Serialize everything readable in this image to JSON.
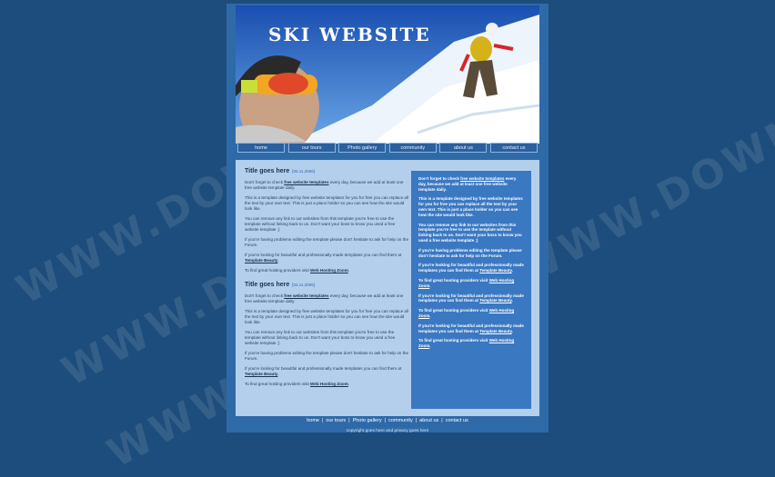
{
  "watermark": "WWW.DOWNDEMO",
  "header": {
    "title": "SKI WEBSITE"
  },
  "nav": [
    "home",
    "our tours",
    "Photo gallery",
    "community",
    "about us",
    "contact us"
  ],
  "posts": [
    {
      "title": "Title goes here",
      "date": "[05.11.2006]",
      "p1_pre": "Don't forget to check ",
      "p1_link": "free website templates",
      "p1_post": " every day, because we add at least one free website template daily.",
      "p2": "This is a template designed by free website templates for you for free you can replace all the text by your own text. This is just a place holder so you can see how the site would look like.",
      "p3": "You can remove any link to our websites from this template you're free to use the template without linking back to us. Don't want your boss to know you used a free website template ;)",
      "p4": "If you're having problems editing the template please don't hesitate to ask for help on the Forum.",
      "p5_pre": "If you're looking for beautiful and professionally made templates you can find them at ",
      "p5_link": "Template Beauty",
      "p5_post": ".",
      "p6_pre": "To find great hosting providers visit ",
      "p6_link": "Web Hosting Zoom",
      "p6_post": "."
    },
    {
      "title": "Title goes here",
      "date": "[04.11.2006]",
      "p1_pre": "Don't forget to check ",
      "p1_link": "free website templates",
      "p1_post": " every day, because we add at least one free website template daily.",
      "p2": "This is a template designed by free website templates for you for free you can replace all the text by your own text. This is just a place holder so you can see how the site would look like.",
      "p3": "You can remove any link to our websites from this template you're free to use the template without linking back to us. Don't want your boss to know you used a free website template ;)",
      "p4": "If you're having problems editing the template please don't hesitate to ask for help on the Forum.",
      "p5_pre": "If you're looking for beautiful and professionally made templates you can find them at ",
      "p5_link": "Template Beauty",
      "p5_post": ".",
      "p6_pre": "To find great hosting providers visit ",
      "p6_link": "Web Hosting Zoom",
      "p6_post": "."
    }
  ],
  "sidebar": {
    "s1_pre": "Don't forget to check ",
    "s1_link": "free website templates",
    "s1_post": " every day, because we add at least one free website template daily.",
    "s2": "This is a template designed by free website templates for you for free you can replace all the text by your own text. This is just a place holder so you can see how the site would look like.",
    "s3": "You can remove any link to our websites from this template you're free to use the template without linking back to us. Don't want your boss to know you used a free website template ;)",
    "s4": "If you're having problems editing the template please don't hesitate to ask for help on the Forum.",
    "s5_pre": "If you're looking for beautiful and professionally made templates you can find them at ",
    "s5_link": "Template Beauty",
    "s5_post": ".",
    "s6_pre": "To find great hosting providers visit ",
    "s6_link": "Web Hosting Zoom",
    "s6_post": ".",
    "s7_pre": "If you're looking for beautiful and professionally made templates you can find them at ",
    "s7_link": "Template Beauty",
    "s7_post": ".",
    "s8_pre": "To find great hosting providers visit ",
    "s8_link": "Web Hosting Zoom",
    "s8_post": ".",
    "s9_pre": "If you're looking for beautiful and professionally made templates you can find them at ",
    "s9_link": "Template Beauty",
    "s9_post": ".",
    "s10_pre": "To find great hosting providers visit ",
    "s10_link": "Web Hosting Zoom",
    "s10_post": "."
  },
  "footer": {
    "links": [
      "home",
      "our tours",
      "Photo gallery",
      "community",
      "about us",
      "contact us"
    ],
    "separator": "|",
    "copyright": "copyright goes here and privacy goes here"
  }
}
